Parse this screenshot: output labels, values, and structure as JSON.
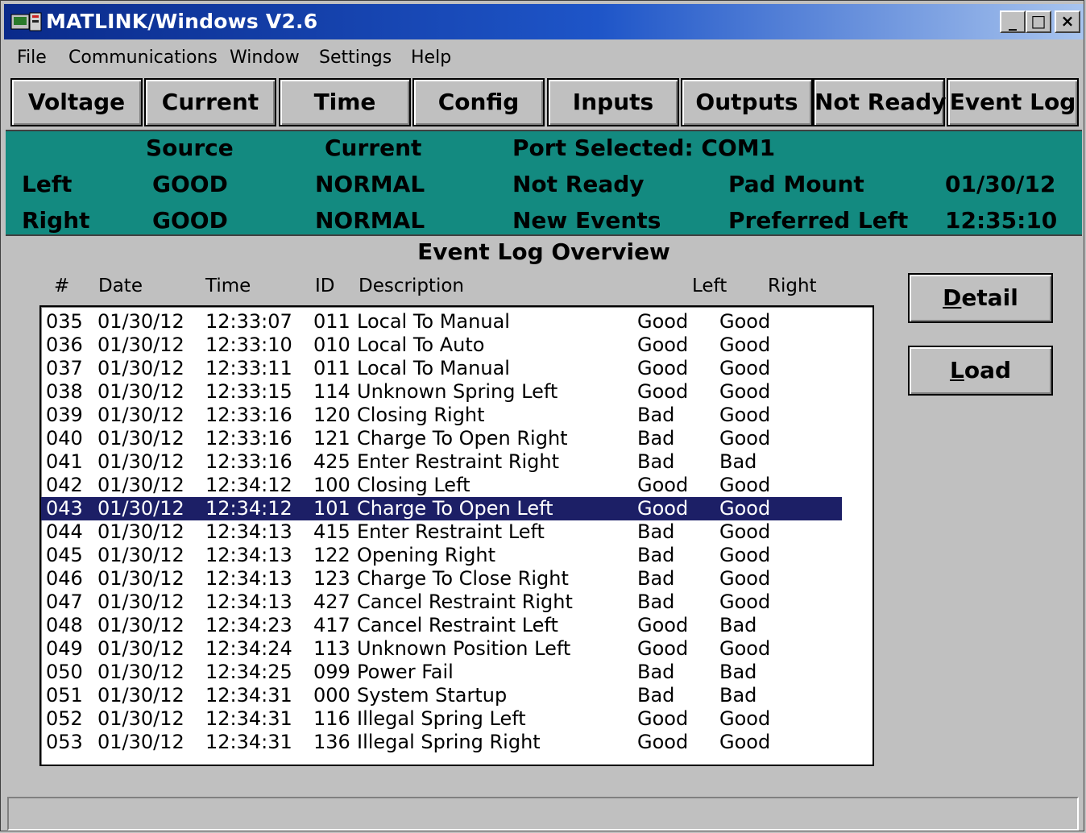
{
  "window": {
    "title": "MATLINK/Windows V2.6",
    "controls": {
      "minimize": "_",
      "maximize": "□",
      "close": "×"
    }
  },
  "menu": [
    "File",
    "Communications",
    "Window",
    "Settings",
    "Help"
  ],
  "tabs": [
    "Voltage",
    "Current",
    "Time",
    "Config",
    "Inputs",
    "Outputs",
    "Not Ready",
    "Event Log"
  ],
  "status": {
    "source_header": "Source",
    "current_header": "Current",
    "port_selected": "Port Selected: COM1",
    "left_label": "Left",
    "right_label": "Right",
    "left_source": "GOOD",
    "right_source": "GOOD",
    "left_current": "NORMAL",
    "right_current": "NORMAL",
    "ready_state": "Not Ready",
    "events_state": "New Events",
    "mount": "Pad Mount",
    "preferred": "Preferred Left",
    "date": "01/30/12",
    "time": "12:35:10",
    "panel_color": "#138a80"
  },
  "overview": {
    "title": "Event Log Overview",
    "columns": [
      "#",
      "Date",
      "Time",
      "ID",
      "Description",
      "Left",
      "Right"
    ],
    "selected_row": 8,
    "rows": [
      [
        "035",
        "01/30/12",
        "12:33:07",
        "011",
        "Local To Manual",
        "Good",
        "Good"
      ],
      [
        "036",
        "01/30/12",
        "12:33:10",
        "010",
        "Local To Auto",
        "Good",
        "Good"
      ],
      [
        "037",
        "01/30/12",
        "12:33:11",
        "011",
        "Local To Manual",
        "Good",
        "Good"
      ],
      [
        "038",
        "01/30/12",
        "12:33:15",
        "114",
        "Unknown Spring Left",
        "Good",
        "Good"
      ],
      [
        "039",
        "01/30/12",
        "12:33:16",
        "120",
        "Closing Right",
        "Bad",
        "Good"
      ],
      [
        "040",
        "01/30/12",
        "12:33:16",
        "121",
        "Charge To Open Right",
        "Bad",
        "Good"
      ],
      [
        "041",
        "01/30/12",
        "12:33:16",
        "425",
        "Enter Restraint Right",
        "Bad",
        "Bad"
      ],
      [
        "042",
        "01/30/12",
        "12:34:12",
        "100",
        "Closing Left",
        "Good",
        "Good"
      ],
      [
        "043",
        "01/30/12",
        "12:34:12",
        "101",
        "Charge To Open Left",
        "Good",
        "Good"
      ],
      [
        "044",
        "01/30/12",
        "12:34:13",
        "415",
        "Enter Restraint Left",
        "Bad",
        "Good"
      ],
      [
        "045",
        "01/30/12",
        "12:34:13",
        "122",
        "Opening Right",
        "Bad",
        "Good"
      ],
      [
        "046",
        "01/30/12",
        "12:34:13",
        "123",
        "Charge To Close Right",
        "Bad",
        "Good"
      ],
      [
        "047",
        "01/30/12",
        "12:34:13",
        "427",
        "Cancel Restraint Right",
        "Bad",
        "Good"
      ],
      [
        "048",
        "01/30/12",
        "12:34:23",
        "417",
        "Cancel Restraint Left",
        "Good",
        "Bad"
      ],
      [
        "049",
        "01/30/12",
        "12:34:24",
        "113",
        "Unknown Position Left",
        "Good",
        "Good"
      ],
      [
        "050",
        "01/30/12",
        "12:34:25",
        "099",
        "Power Fail",
        "Bad",
        "Bad"
      ],
      [
        "051",
        "01/30/12",
        "12:34:31",
        "000",
        "System Startup",
        "Bad",
        "Bad"
      ],
      [
        "052",
        "01/30/12",
        "12:34:31",
        "116",
        "Illegal Spring Left",
        "Good",
        "Good"
      ],
      [
        "053",
        "01/30/12",
        "12:34:31",
        "136",
        "Illegal Spring Right",
        "Good",
        "Good"
      ]
    ]
  },
  "buttons": {
    "detail_first": "D",
    "detail_rest": "etail",
    "load_first": "L",
    "load_rest": "oad"
  },
  "statusbar_text": ""
}
